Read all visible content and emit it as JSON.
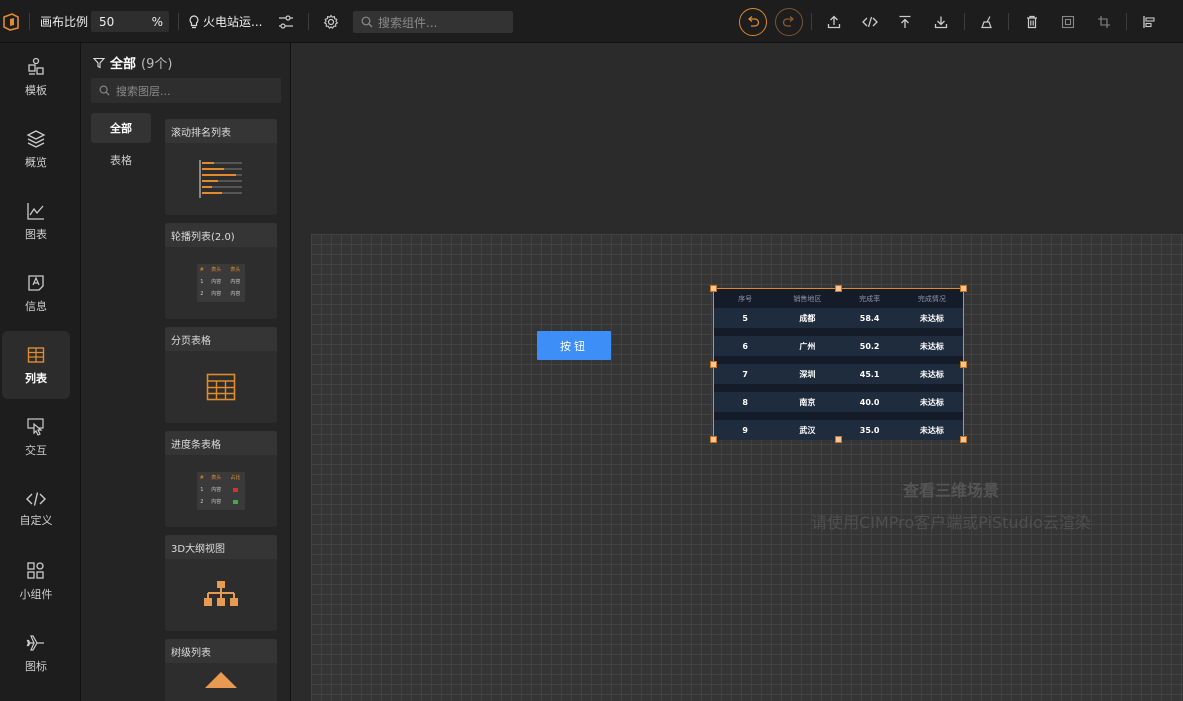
{
  "toolbar": {
    "canvas_ratio_label": "画布比例",
    "ratio_value": "50",
    "ratio_unit": "%",
    "scene_name": "火电站运...",
    "search_placeholder": "搜索组件...",
    "accent_color": "#d8892d"
  },
  "nav": {
    "items": [
      {
        "label": "模板",
        "icon": "template-icon"
      },
      {
        "label": "概览",
        "icon": "layers-icon"
      },
      {
        "label": "图表",
        "icon": "chart-icon"
      },
      {
        "label": "信息",
        "icon": "text-icon"
      },
      {
        "label": "列表",
        "icon": "table-icon"
      },
      {
        "label": "交互",
        "icon": "pointer-icon"
      },
      {
        "label": "自定义",
        "icon": "code-icon"
      },
      {
        "label": "小组件",
        "icon": "widgets-icon"
      },
      {
        "label": "图标",
        "icon": "plane-icon"
      }
    ],
    "active": "列表"
  },
  "panel": {
    "title": "全部",
    "count": "(9个)",
    "search_placeholder": "搜索图层...",
    "categories": [
      "全部",
      "表格"
    ],
    "cards": [
      {
        "title": "滚动排名列表",
        "icon": "ranking-list-icon"
      },
      {
        "title": "轮播列表(2.0)",
        "icon": "carousel-table-icon"
      },
      {
        "title": "分页表格",
        "icon": "grid-table-icon"
      },
      {
        "title": "进度条表格",
        "icon": "progress-table-icon"
      },
      {
        "title": "3D大纲视图",
        "icon": "tree-hierarchy-icon"
      },
      {
        "title": "树级列表",
        "icon": "tree-list-icon"
      }
    ],
    "thumb_table": {
      "headers": [
        "#",
        "表头",
        "表头"
      ],
      "rows": [
        [
          "1",
          "内容",
          "内容"
        ],
        [
          "2",
          "内容",
          "内容"
        ]
      ]
    },
    "thumb_progress": {
      "headers": [
        "#",
        "表头",
        "占比"
      ],
      "rows": [
        [
          "1",
          "内容"
        ],
        [
          "2",
          "内容"
        ]
      ]
    }
  },
  "canvas": {
    "button_label": "按钮",
    "table": {
      "headers": [
        "序号",
        "销售地区",
        "完成率",
        "完成情况"
      ],
      "rows": [
        [
          "5",
          "成都",
          "58.4",
          "未达标"
        ],
        [
          "6",
          "广州",
          "50.2",
          "未达标"
        ],
        [
          "7",
          "深圳",
          "45.1",
          "未达标"
        ],
        [
          "8",
          "南京",
          "40.0",
          "未达标"
        ],
        [
          "9",
          "武汉",
          "35.0",
          "未达标"
        ]
      ]
    },
    "hint_title": "查看三维场景",
    "hint_subtitle": "请使用CIMPro客户端或PiStudio云渲染"
  }
}
